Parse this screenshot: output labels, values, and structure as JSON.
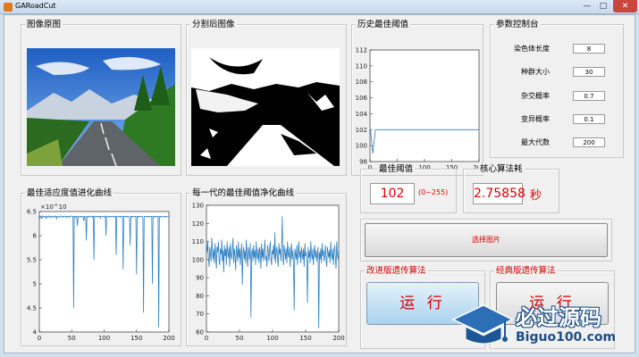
{
  "window": {
    "title": "GARoadCut",
    "min_glyph": "—",
    "max_glyph": "□",
    "close_glyph": "✕"
  },
  "panels": {
    "original": {
      "title": "图像原图"
    },
    "segmented": {
      "title": "分割后图像"
    },
    "history": {
      "title": "历史最佳阈值"
    },
    "params": {
      "title": "参数控制台"
    },
    "fitness": {
      "title": "最佳适应度值进化曲线",
      "exponent": "×10^10"
    },
    "evolution": {
      "title": "每一代的最佳阈值净化曲线"
    },
    "best_threshold": {
      "title": "最佳阈值",
      "value": "102",
      "range": "(0~255)"
    },
    "time": {
      "title": "核心算法耗",
      "value": "2.75858",
      "unit": "秒"
    },
    "improved": {
      "title": "改进版遗传算法",
      "run_label": "运 行"
    },
    "classic": {
      "title": "经典版遗传算法",
      "run_label": "运 行"
    }
  },
  "params": [
    {
      "label": "染色体长度",
      "value": "8"
    },
    {
      "label": "种群大小",
      "value": "30"
    },
    {
      "label": "杂交概率",
      "value": "0.7"
    },
    {
      "label": "变异概率",
      "value": "0.1"
    },
    {
      "label": "最大代数",
      "value": "200"
    }
  ],
  "select_image_label": "选择图片",
  "watermark": {
    "cn": "必过源码",
    "en": "Biguo100.com"
  },
  "colors": {
    "line": "#2d7fc1",
    "red": "#e00000",
    "sky": "#2f78d6"
  },
  "chart_data": [
    {
      "type": "line",
      "name": "history_best_threshold",
      "x": [
        0,
        1,
        5,
        10,
        200
      ],
      "y": [
        102,
        102,
        99,
        102,
        102
      ],
      "xlim": [
        0,
        200
      ],
      "ylim": [
        98,
        112
      ],
      "xticks": [
        "0",
        "50",
        "100",
        "150",
        "200"
      ],
      "yticks": [
        "98",
        "100",
        "102",
        "104",
        "106",
        "108",
        "110",
        "112"
      ]
    },
    {
      "type": "line",
      "name": "fitness_evolution",
      "x_range": [
        0,
        200
      ],
      "ylim": [
        4,
        6.5
      ],
      "y_multiplier": "1e10",
      "xticks": [
        "0",
        "50",
        "100",
        "150",
        "200"
      ],
      "yticks": [
        "4",
        "4.5",
        "5",
        "5.5",
        "6",
        "6.5"
      ],
      "y": [
        6.32,
        6.4,
        6.38,
        6.4,
        6.35,
        6.41,
        6.4,
        6.39,
        6.4,
        6.38,
        6.4,
        6.36,
        6.4,
        6.4,
        6.38,
        6.41,
        6.4,
        6.4,
        6.37,
        6.4,
        6.4,
        6.39,
        6.4,
        6.38,
        6.41,
        6.4,
        6.4,
        6.35,
        6.4,
        6.4,
        6.39,
        6.4,
        6.38,
        6.4,
        6.41,
        6.4,
        6.4,
        6.38,
        6.4,
        6.4,
        6.39,
        6.4,
        6.4,
        6.37,
        6.4,
        6.4,
        6.4,
        6.38,
        6.4,
        6.4,
        6.41,
        6.4,
        6.39,
        6.4,
        4.5,
        6.4,
        6.4,
        6.38,
        6.4,
        6.4,
        6.2,
        6.4,
        6.4,
        6.39,
        6.4,
        6.4,
        6.38,
        6.4,
        6.4,
        6.4,
        6.3,
        6.4,
        6.4,
        6.39,
        5.9,
        6.4,
        6.4,
        6.38,
        6.4,
        6.4,
        6.4,
        6.39,
        6.4,
        6.4,
        6.38,
        6.4,
        5.5,
        6.4,
        6.4,
        6.39,
        6.4,
        6.4,
        6.38,
        6.4,
        6.4,
        6.4,
        6.36,
        6.4,
        6.4,
        6.4,
        6.39,
        6.4,
        6.4,
        6.38,
        6.4,
        6.0,
        6.4,
        6.4,
        6.39,
        6.4,
        6.4,
        6.38,
        6.4,
        6.4,
        6.4,
        6.39,
        6.4,
        6.4,
        6.38,
        6.4,
        6.4,
        5.6,
        6.4,
        6.4,
        6.4,
        6.39,
        6.4,
        6.4,
        6.38,
        6.4,
        6.4,
        6.4,
        5.3,
        6.4,
        6.4,
        6.39,
        6.4,
        6.4,
        6.38,
        6.4,
        6.4,
        6.4,
        6.39,
        5.8,
        6.4,
        6.4,
        6.38,
        6.4,
        6.4,
        6.4,
        6.39,
        6.4,
        6.4,
        5.2,
        6.4,
        6.4,
        6.38,
        6.4,
        6.4,
        6.4,
        6.39,
        6.4,
        6.4,
        6.38,
        4.4,
        6.4,
        6.4,
        6.4,
        6.39,
        6.4,
        6.4,
        6.38,
        6.4,
        6.4,
        6.4,
        6.39,
        6.4,
        6.4,
        5.0,
        6.4,
        6.4,
        6.38,
        6.4,
        6.4,
        6.4,
        6.39,
        6.4,
        6.4,
        4.1,
        6.4,
        6.4,
        6.38,
        6.4,
        6.4,
        6.4,
        6.39,
        6.4,
        6.4,
        6.38,
        6.4,
        6.4,
        6.4,
        6.39,
        6.4,
        6.4
      ]
    },
    {
      "type": "line",
      "name": "per_generation_best_threshold",
      "x_range": [
        0,
        200
      ],
      "ylim": [
        60,
        130
      ],
      "xticks": [
        "0",
        "50",
        "100",
        "150",
        "200"
      ],
      "yticks": [
        "60",
        "70",
        "80",
        "90",
        "100",
        "110",
        "120",
        "130"
      ],
      "y": [
        108,
        104,
        110,
        101,
        96,
        107,
        103,
        99,
        112,
        105,
        100,
        106,
        98,
        109,
        102,
        95,
        107,
        104,
        110,
        100,
        97,
        106,
        103,
        111,
        99,
        105,
        93,
        108,
        102,
        106,
        97,
        110,
        104,
        101,
        107,
        96,
        109,
        103,
        100,
        105,
        112,
        98,
        106,
        102,
        94,
        108,
        104,
        99,
        110,
        101,
        106,
        97,
        104,
        109,
        86,
        103,
        107,
        100,
        105,
        98,
        111,
        102,
        96,
        107,
        104,
        100,
        109,
        68,
        103,
        106,
        99,
        108,
        101,
        105,
        97,
        110,
        103,
        100,
        106,
        98,
        107,
        104,
        95,
        109,
        101,
        106,
        99,
        104,
        111,
        100,
        102,
        96,
        108,
        104,
        99,
        106,
        110,
        101,
        97,
        105,
        103,
        108,
        100,
        115,
        98,
        104,
        107,
        101,
        96,
        109,
        103,
        106,
        99,
        105,
        124,
        101,
        97,
        108,
        104,
        100,
        106,
        98,
        110,
        103,
        101,
        107,
        96,
        104,
        109,
        100,
        105,
        99,
        72,
        106,
        103,
        100,
        108,
        97,
        104,
        110,
        101,
        105,
        98,
        107,
        103,
        100,
        106,
        96,
        109,
        102,
        104,
        99,
        76,
        107,
        101,
        105,
        98,
        110,
        103,
        100,
        106,
        97,
        104,
        108,
        101,
        105,
        99,
        103,
        107,
        62,
        104,
        100,
        106,
        98,
        109,
        102,
        105,
        99,
        103,
        108,
        100,
        96,
        107,
        104,
        101,
        105,
        98,
        110,
        103,
        100,
        106,
        97,
        104,
        108,
        101,
        95,
        110,
        103,
        100,
        106
      ]
    }
  ]
}
